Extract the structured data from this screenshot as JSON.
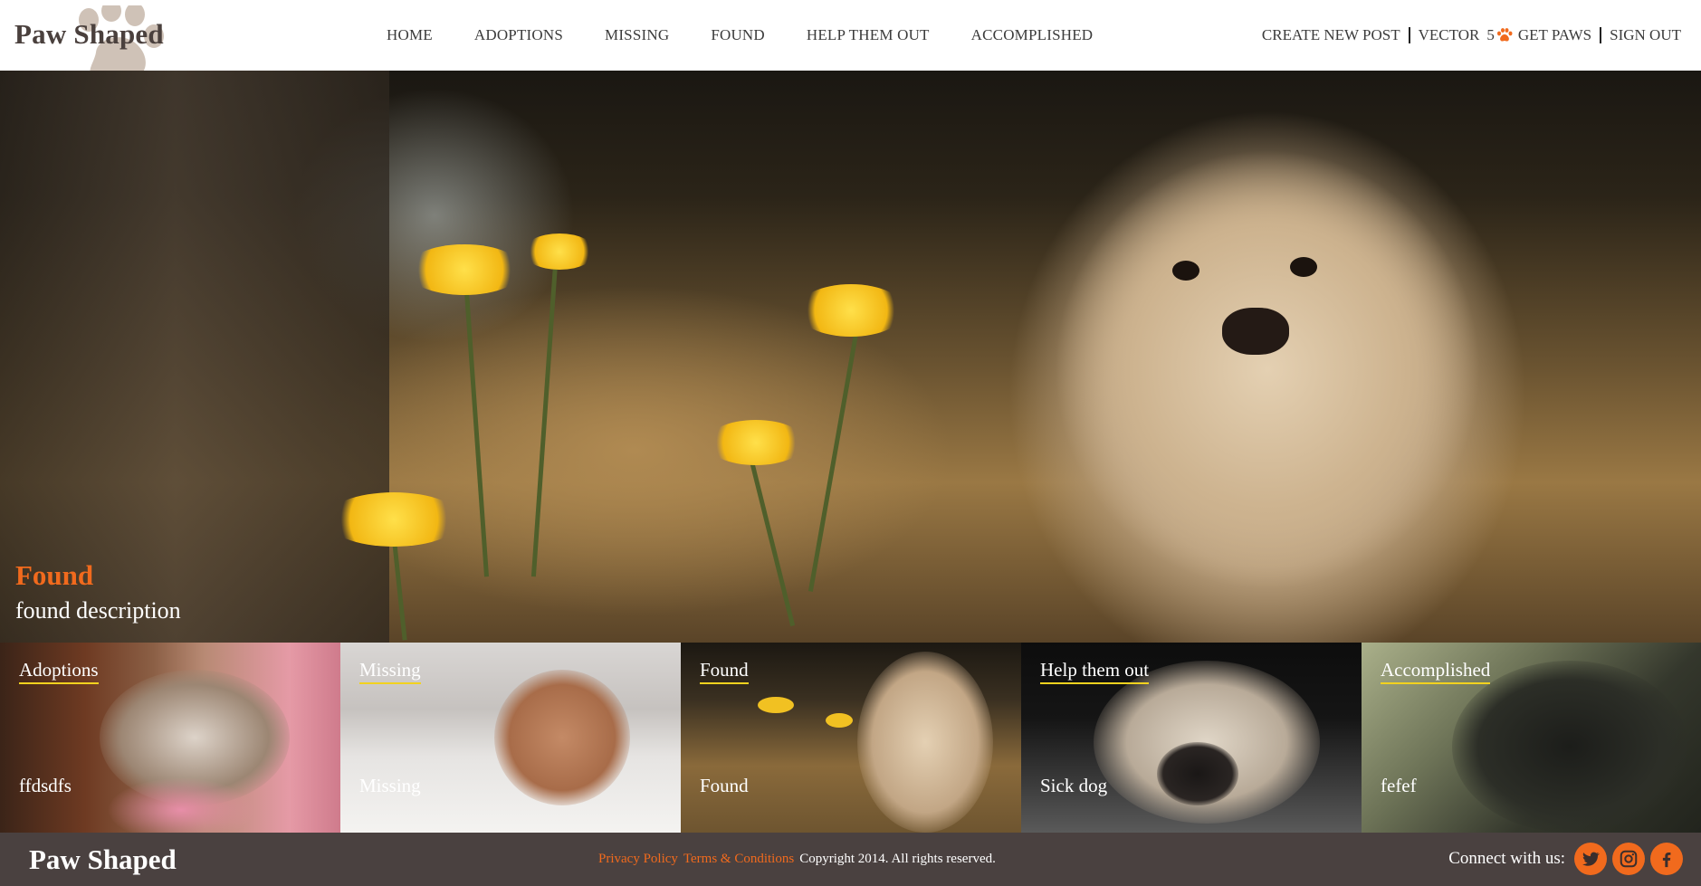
{
  "brand": {
    "name": "Paw Shaped"
  },
  "nav": {
    "items": [
      "HOME",
      "ADOPTIONS",
      "MISSING",
      "FOUND",
      "HELP THEM OUT",
      "ACCOMPLISHED"
    ]
  },
  "user_nav": {
    "create_post": "CREATE NEW POST",
    "username": "VECTOR",
    "paw_count": "5",
    "get_paws": "GET PAWS",
    "sign_out": "SIGN OUT"
  },
  "hero": {
    "title": "Found",
    "description": "found description"
  },
  "tiles": [
    {
      "heading": "Adoptions",
      "description": "ffdsdfs"
    },
    {
      "heading": "Missing",
      "description": "Missing"
    },
    {
      "heading": "Found",
      "description": "Found"
    },
    {
      "heading": "Help them out",
      "description": "Sick dog"
    },
    {
      "heading": "Accomplished",
      "description": "fefef"
    }
  ],
  "footer": {
    "brand": "Paw Shaped",
    "privacy": "Privacy Policy",
    "terms": "Terms & Conditions",
    "copyright": "Copyright 2014. All rights reserved.",
    "connect_label": "Connect with us:",
    "social": [
      "twitter-icon",
      "instagram-icon",
      "facebook-icon"
    ]
  },
  "colors": {
    "accent": "#f16a1d",
    "underline": "#f2d21f",
    "footer_bg": "#4a4140",
    "logo_text": "#4a403d"
  }
}
